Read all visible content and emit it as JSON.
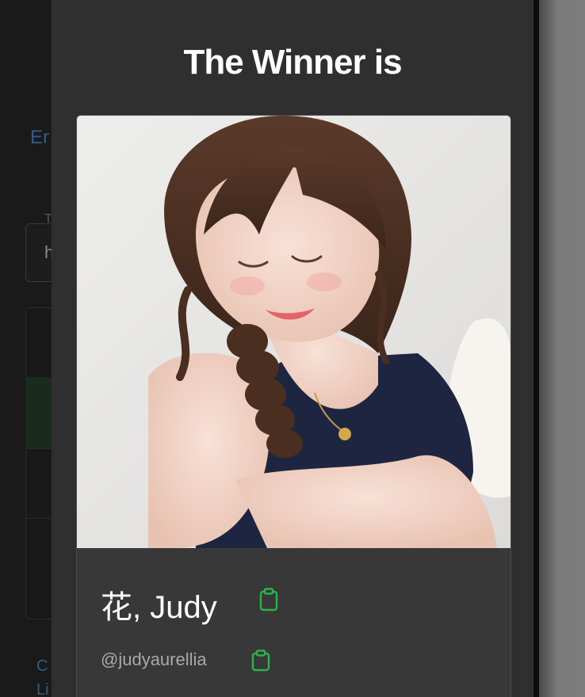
{
  "background": {
    "link_text": "Er",
    "field_label": "T",
    "field_value": "h",
    "link2_text": "C",
    "link3_text": "Li"
  },
  "modal": {
    "title": "The Winner is",
    "winner": {
      "name": "花, Judy",
      "handle": "@judyaurellia",
      "name_copy_icon": "clipboard-icon",
      "handle_copy_icon": "clipboard-icon"
    }
  },
  "colors": {
    "accent_green": "#2fb04c",
    "modal_bg": "#2f2f2f",
    "card_bg": "#383838"
  }
}
